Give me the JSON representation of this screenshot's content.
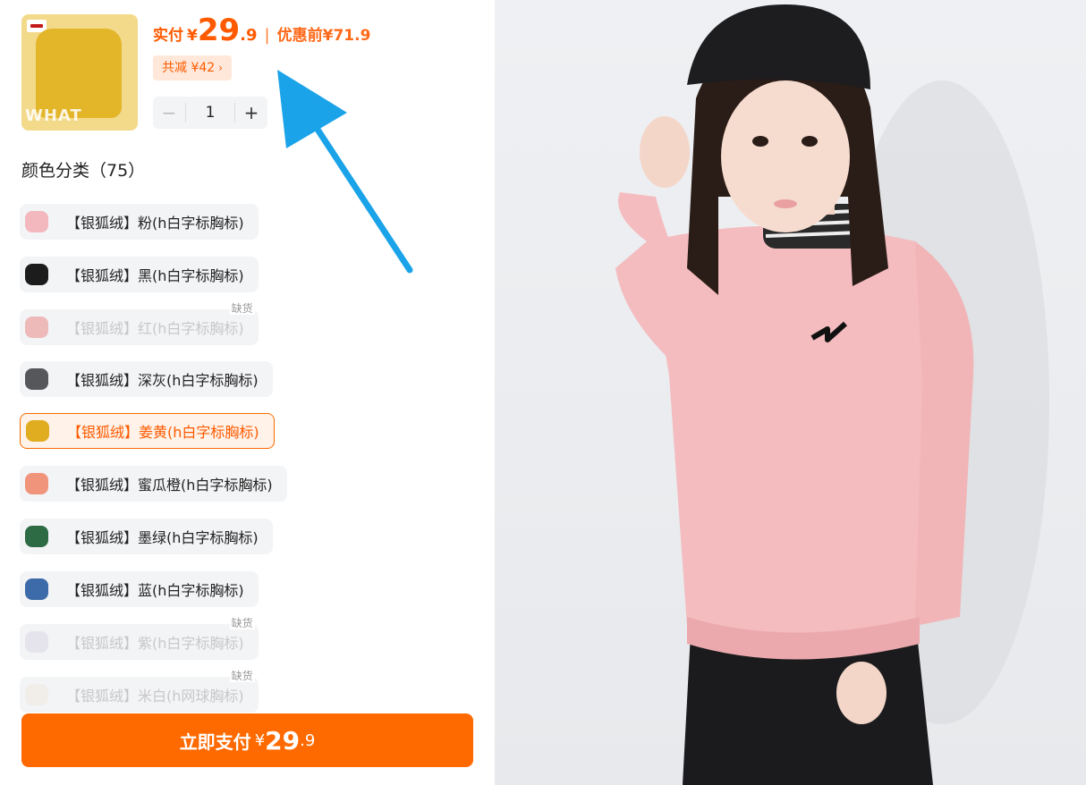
{
  "product": {
    "price_label": "实付",
    "currency": "¥",
    "price_int": "29",
    "price_dec": ".9",
    "separator": "|",
    "orig_label": "优惠前",
    "orig_price": "¥71.9",
    "discount": "共减 ¥42",
    "quantity": "1",
    "minus": "−",
    "plus": "+",
    "thumb_text": "WHAT"
  },
  "colors": {
    "title": "颜色分类（75）",
    "items": [
      {
        "label": "【银狐绒】粉(h白字标胸标)",
        "swatch": "#f2b8bd",
        "state": "normal"
      },
      {
        "label": "【银狐绒】黑(h白字标胸标)",
        "swatch": "#1c1c1c",
        "state": "normal"
      },
      {
        "label": "【银狐绒】红(h白字标胸标)",
        "swatch": "#e7736f",
        "state": "disabled",
        "badge": "缺货"
      },
      {
        "label": "【银狐绒】深灰(h白字标胸标)",
        "swatch": "#55575a",
        "state": "normal"
      },
      {
        "label": "【银狐绒】姜黄(h白字标胸标)",
        "swatch": "#e0ad20",
        "state": "selected"
      },
      {
        "label": "【银狐绒】蜜瓜橙(h白字标胸标)",
        "swatch": "#f0957c",
        "state": "normal"
      },
      {
        "label": "【银狐绒】墨绿(h白字标胸标)",
        "swatch": "#2d6b45",
        "state": "normal"
      },
      {
        "label": "【银狐绒】蓝(h白字标胸标)",
        "swatch": "#3d6aa8",
        "state": "normal"
      },
      {
        "label": "【银狐绒】紫(h白字标胸标)",
        "swatch": "#d5d1e3",
        "state": "disabled",
        "badge": "缺货"
      },
      {
        "label": "【银狐绒】米白(h网球胸标)",
        "swatch": "#efe7dc",
        "state": "disabled",
        "badge": "缺货"
      }
    ]
  },
  "pay": {
    "label": "立即支付",
    "currency": "¥",
    "int": "29",
    "dec": ".9"
  },
  "accent": "#ff6a00",
  "arrow_color": "#1aa3e8"
}
